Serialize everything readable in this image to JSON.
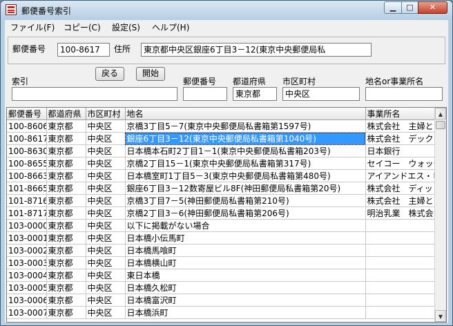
{
  "window": {
    "title": "郵便番号索引",
    "min_glyph": "▁",
    "max_glyph": "□",
    "close_glyph": "✕"
  },
  "menu": [
    "ファイル(F)",
    "コピー(C)",
    "設定(S)",
    "ヘルプ(H)"
  ],
  "address": {
    "postal_label": "郵便番号",
    "postal_value": "100-8617",
    "address_label": "住所",
    "address_value": "東京都中央区銀座6丁目3－12(東京中央郵便局私"
  },
  "search": {
    "index_label": "索引",
    "index_value": "",
    "back_button": "戻る",
    "start_button": "開始",
    "postal_label": "郵便番号",
    "postal_value": "",
    "pref_label": "都道府県",
    "pref_value": "東京都",
    "city_label": "市区町村",
    "city_value": "中央区",
    "place_label": "地名or事業所名",
    "place_value": ""
  },
  "table": {
    "headers": [
      "郵便番号",
      "都道府県",
      "市区町村",
      "地名",
      "事業所名"
    ],
    "rows": [
      [
        "100-8606",
        "東京都",
        "中央区",
        "京橋3丁目5－7(東京中央郵便局私書箱第1597号)",
        "株式会社　主婦と"
      ],
      [
        "100-8617",
        "東京都",
        "中央区",
        "銀座6丁目3－12(東京中央郵便局私書箱第1040号)",
        "株式会社　デック"
      ],
      [
        "100-8630",
        "東京都",
        "中央区",
        "日本橋本石町2丁目1－1(東京中央郵便局私書箱203号)",
        "日本銀行"
      ],
      [
        "100-8655",
        "東京都",
        "中央区",
        "京橋2丁目15－1(東京中央郵便局私書箱第317号)",
        "セイコー　ウォッチ"
      ],
      [
        "100-8663",
        "東京都",
        "中央区",
        "日本橋室町1丁目5－3(東京中央郵便局私書箱第480号)",
        "アイアンドエス・ビ"
      ],
      [
        "101-8665",
        "東京都",
        "中央区",
        "銀座6丁目3－12数寄屋ビル8F(神田郵便局私書箱第20号)",
        "株式会社　ディッ"
      ],
      [
        "101-8716",
        "東京都",
        "中央区",
        "京橋3丁目7－5(神田郵便局私書箱第210号)",
        "株式会社　主婦と"
      ],
      [
        "101-8717",
        "東京都",
        "中央区",
        "京橋2丁目3－6(神田郵便局私書箱第206号)",
        "明治乳業　株式会"
      ],
      [
        "103-0000",
        "東京都",
        "中央区",
        "以下に掲載がない場合",
        ""
      ],
      [
        "103-0001",
        "東京都",
        "中央区",
        "日本橋小伝馬町",
        ""
      ],
      [
        "103-0002",
        "東京都",
        "中央区",
        "日本橋馬喰町",
        ""
      ],
      [
        "103-0003",
        "東京都",
        "中央区",
        "日本橋横山町",
        ""
      ],
      [
        "103-0004",
        "東京都",
        "中央区",
        "東日本橋",
        ""
      ],
      [
        "103-0005",
        "東京都",
        "中央区",
        "日本橋久松町",
        ""
      ],
      [
        "103-0006",
        "東京都",
        "中央区",
        "日本橋富沢町",
        ""
      ],
      [
        "103-0007",
        "東京都",
        "中央区",
        "日本橋浜町",
        ""
      ]
    ],
    "selected_row": 1
  }
}
